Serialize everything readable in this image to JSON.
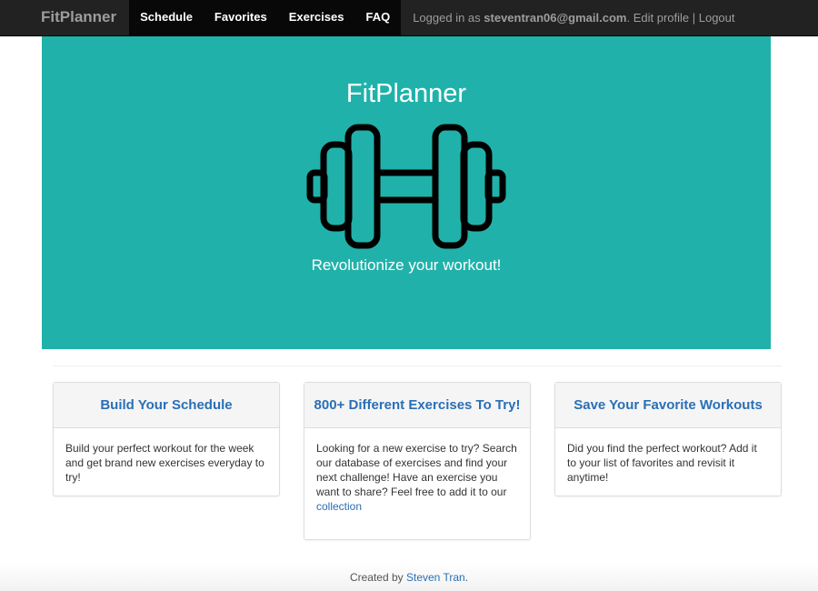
{
  "navbar": {
    "brand": "FitPlanner",
    "links": [
      "Schedule",
      "Favorites",
      "Exercises",
      "FAQ"
    ],
    "logged_in_prefix": "Logged in as ",
    "user_email": "steventran06@gmail.com",
    "after_email": ". ",
    "edit_profile": "Edit profile",
    "separator": " | ",
    "logout": "Logout"
  },
  "hero": {
    "title": "FitPlanner",
    "icon": "dumbbell-icon",
    "subtitle": "Revolutionize your workout!",
    "color": "#20b2aa"
  },
  "panels": [
    {
      "heading": "Build Your Schedule",
      "body": "Build your perfect workout for the week and get brand new exercises everyday to try!"
    },
    {
      "heading": "800+ Different Exercises To Try!",
      "body": "Looking for a new exercise to try? Search our database of exercises and find your next challenge! Have an exercise you want to share? Feel free to add it to our ",
      "link": "collection"
    },
    {
      "heading": "Save Your Favorite Workouts",
      "body": "Did you find the perfect workout? Add it to your list of favorites and revisit it anytime!"
    }
  ],
  "footer": {
    "prefix": "Created by ",
    "author": "Steven Tran",
    "suffix": "."
  },
  "colors": {
    "accent": "#20b2aa",
    "link": "#2a6fb5",
    "navbar": "#222222"
  }
}
